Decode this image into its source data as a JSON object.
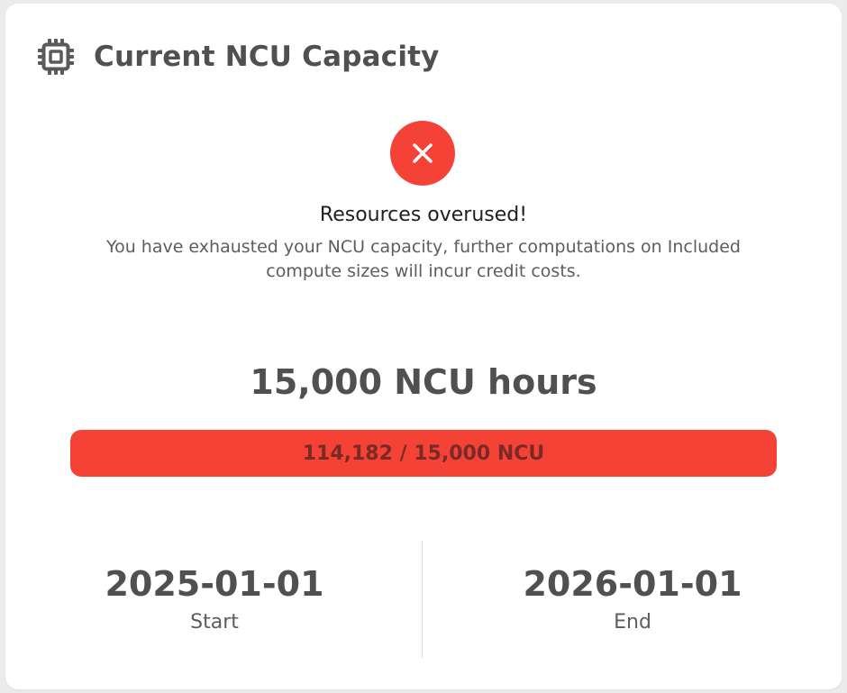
{
  "header": {
    "icon": "chip-icon",
    "title": "Current NCU Capacity"
  },
  "status": {
    "icon": "close-icon",
    "color": "#f44336",
    "title": "Resources overused!",
    "message": "You have exhausted your NCU capacity, further computations on Included compute sizes will incur credit costs."
  },
  "capacity": {
    "headline": "15,000 NCU hours",
    "used": 114182,
    "total": 15000,
    "fill_fraction": 1.0,
    "bar_label": "114,182 / 15,000 NCU",
    "bar_color": "#f44336"
  },
  "period": {
    "start": {
      "value": "2025-01-01",
      "label": "Start"
    },
    "end": {
      "value": "2026-01-01",
      "label": "End"
    }
  }
}
